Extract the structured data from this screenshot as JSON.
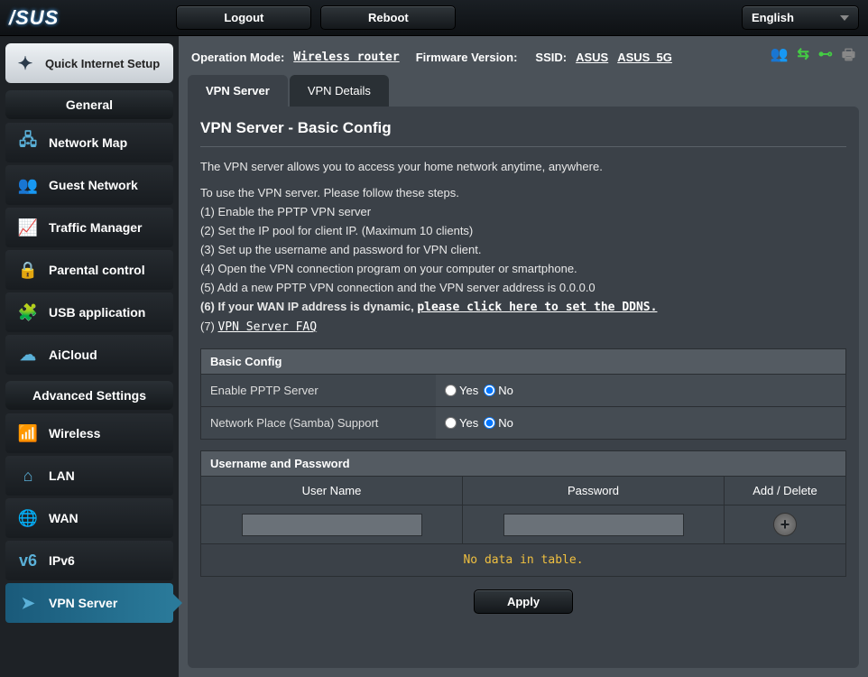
{
  "header": {
    "logo_text": "/SUS",
    "logout": "Logout",
    "reboot": "Reboot",
    "language": "English"
  },
  "sidebar": {
    "quick_setup": "Quick Internet Setup",
    "general_label": "General",
    "advanced_label": "Advanced Settings",
    "general": [
      {
        "label": "Network Map",
        "icon": "🖧"
      },
      {
        "label": "Guest Network",
        "icon": "👥"
      },
      {
        "label": "Traffic Manager",
        "icon": "📈"
      },
      {
        "label": "Parental control",
        "icon": "🔒"
      },
      {
        "label": "USB application",
        "icon": "🧩"
      },
      {
        "label": "AiCloud",
        "icon": "☁"
      }
    ],
    "advanced": [
      {
        "label": "Wireless",
        "icon": "📶"
      },
      {
        "label": "LAN",
        "icon": "⌂"
      },
      {
        "label": "WAN",
        "icon": "🌐"
      },
      {
        "label": "IPv6",
        "icon": "v6"
      },
      {
        "label": "VPN Server",
        "icon": "➤",
        "active": true
      }
    ]
  },
  "infobar": {
    "op_mode_label": "Operation Mode:",
    "op_mode_value": "Wireless router",
    "fw_label": "Firmware Version:",
    "ssid_label": "SSID:",
    "ssid1": "ASUS",
    "ssid2": "ASUS_5G"
  },
  "tabs": [
    {
      "label": "VPN Server",
      "active": true
    },
    {
      "label": "VPN Details"
    }
  ],
  "page": {
    "title": "VPN Server - Basic Config",
    "intro": "The VPN server allows you to access your home network anytime, anywhere.",
    "follow": "To use the VPN server. Please follow these steps.",
    "step1": "(1) Enable the PPTP VPN server",
    "step2": "(2) Set the IP pool for client IP. (Maximum 10 clients)",
    "step3": "(3) Set up the username and password for VPN client.",
    "step4": "(4) Open the VPN connection program on your computer or smartphone.",
    "step5": "(5) Add a new PPTP VPN connection and the VPN server address is 0.0.0.0",
    "step6_prefix": "(6) If your WAN IP address is dynamic, ",
    "step6_link": "please click here to set the DDNS.",
    "step7_prefix": "(7) ",
    "step7_link": "VPN Server FAQ",
    "basic_config_hdr": "Basic Config",
    "enable_pptp": "Enable PPTP Server",
    "samba": "Network Place (Samba) Support",
    "yes": "Yes",
    "no": "No",
    "userpass_hdr": "Username and Password",
    "col_user": "User Name",
    "col_pass": "Password",
    "col_add": "Add / Delete",
    "nodata": "No data in table.",
    "apply": "Apply"
  }
}
